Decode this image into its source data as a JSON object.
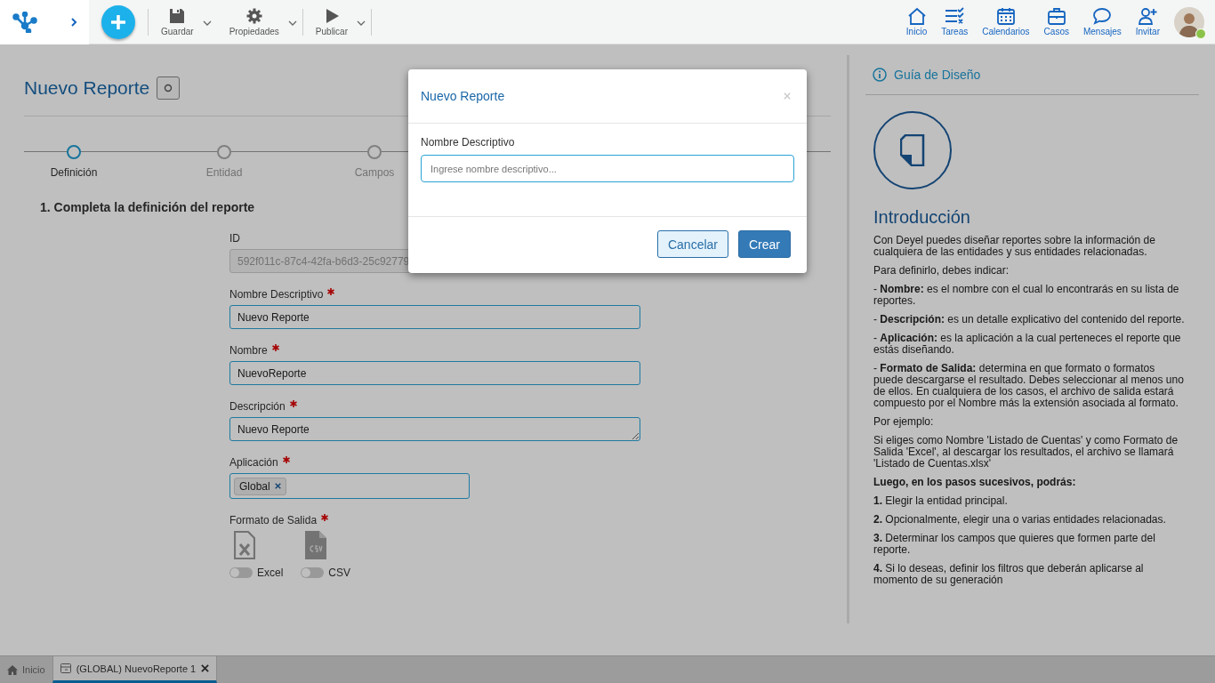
{
  "header": {
    "tools": [
      {
        "label": "Guardar",
        "kind": "save"
      },
      {
        "label": "Propiedades",
        "kind": "gear"
      },
      {
        "label": "Publicar",
        "kind": "play"
      }
    ],
    "nav": [
      {
        "label": "Inicio",
        "kind": "home"
      },
      {
        "label": "Tareas",
        "kind": "tasks"
      },
      {
        "label": "Calendarios",
        "kind": "calendar"
      },
      {
        "label": "Casos",
        "kind": "briefcase"
      },
      {
        "label": "Mensajes",
        "kind": "chat"
      },
      {
        "label": "Invitar",
        "kind": "invite"
      }
    ],
    "user": {
      "online": true
    }
  },
  "page": {
    "title": "Nuevo Reporte",
    "steps": [
      {
        "label": "Definición",
        "selected": true
      },
      {
        "label": "Entidad",
        "selected": false
      },
      {
        "label": "Campos",
        "selected": false
      }
    ],
    "section_title": "1. Completa la definición del reporte",
    "fields": [
      {
        "kind": "text",
        "label": "ID",
        "value": "592f011c-87c4-42fa-b6d3-25c92779",
        "required": false,
        "disabled": true
      },
      {
        "kind": "text",
        "label": "Nombre Descriptivo",
        "value": "Nuevo Reporte",
        "required": true,
        "disabled": false
      },
      {
        "kind": "text",
        "label": "Nombre",
        "value": "NuevoReporte",
        "required": true,
        "disabled": false
      },
      {
        "kind": "textarea",
        "label": "Descripción",
        "value": "Nuevo Reporte",
        "required": true,
        "disabled": false
      },
      {
        "kind": "chips",
        "label": "Aplicación",
        "chips": [
          "Global"
        ],
        "required": true
      },
      {
        "kind": "formats",
        "label": "Formato de Salida",
        "required": true,
        "options": [
          {
            "label": "Excel",
            "kind": "excel",
            "on": false
          },
          {
            "label": "CSV",
            "kind": "csv",
            "on": false
          }
        ]
      }
    ]
  },
  "guide": {
    "title": "Guía de Diseño",
    "heading": "Introducción",
    "paragraphs": [
      "Con Deyel puedes diseñar reportes sobre la información de cualquiera de las entidades y sus entidades relacionadas.",
      "Para definirlo, debes indicar:",
      "- **Nombre:** es el nombre con el cual lo encontrarás en su lista de reportes.",
      "- **Descripción:** es un detalle explicativo del contenido del reporte.",
      "- **Aplicación:** es la aplicación a la cual perteneces el reporte que estás diseñando.",
      "- **Formato de Salida:** determina en que formato o formatos puede descargarse el resultado. Debes seleccionar al menos uno de ellos. En cualquiera de los casos, el archivo de salida estará compuesto por el Nombre más la extensión asociada al formato.",
      "Por ejemplo:",
      "Si eliges como Nombre 'Listado de Cuentas' y como Formato de Salida 'Excel', al descargar los resultados, el archivo se llamará 'Listado de Cuentas.xlsx'"
    ],
    "steps_intro": "Luego, en los pasos sucesivos, podrás:",
    "steps": [
      "**1.** Elegir la entidad principal.",
      "**2.** Opcionalmente, elegir una o varias entidades relacionadas.",
      "**3.** Determinar los campos que quieres que formen parte del reporte.",
      "**4.** Si lo deseas, definir los filtros que deberán aplicarse al momento de su generación"
    ]
  },
  "modal": {
    "title": "Nuevo Reporte",
    "field_label": "Nombre Descriptivo",
    "placeholder": "Ingrese nombre descriptivo...",
    "buttons": [
      {
        "label": "Cancelar",
        "kind": "secondary"
      },
      {
        "label": "Crear",
        "kind": "primary"
      }
    ]
  },
  "tabs": [
    {
      "label": "Inicio",
      "kind": "home",
      "selected": false,
      "closable": false
    },
    {
      "label": "(GLOBAL) NuevoReporte 1",
      "kind": "report",
      "selected": true,
      "closable": true
    }
  ]
}
